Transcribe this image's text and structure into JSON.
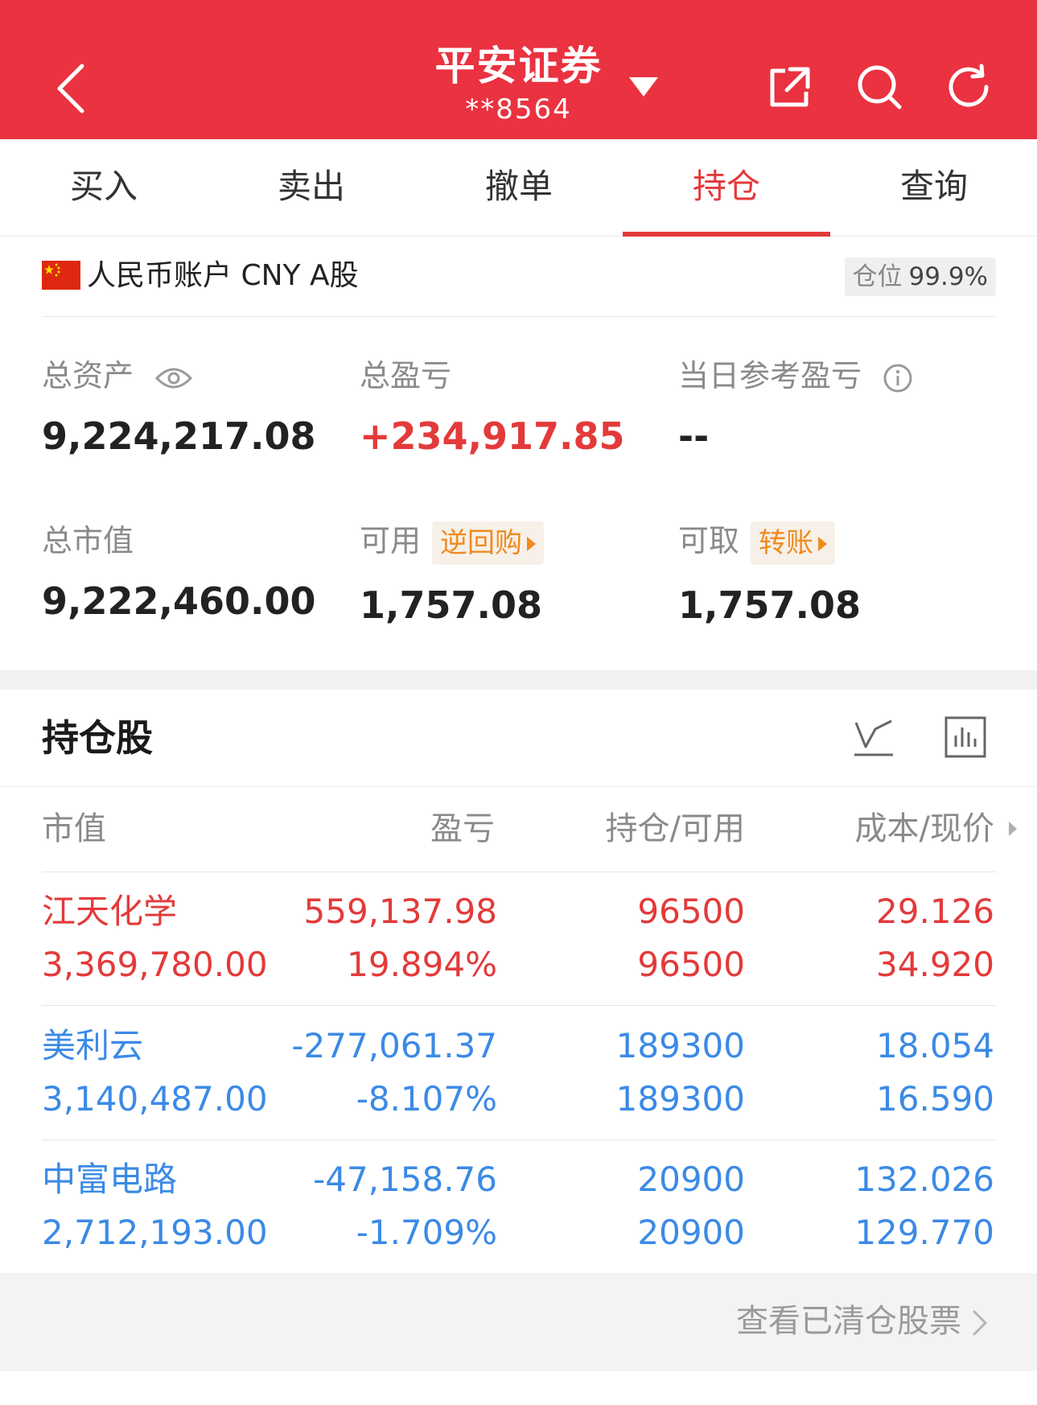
{
  "header": {
    "title": "平安证券",
    "account_masked": "**8564",
    "icons": [
      "back-icon",
      "dropdown-caret-icon",
      "share-icon",
      "search-icon",
      "refresh-icon"
    ]
  },
  "tabs": [
    {
      "label": "买入"
    },
    {
      "label": "卖出"
    },
    {
      "label": "撤单"
    },
    {
      "label": "持仓",
      "active": true
    },
    {
      "label": "查询"
    }
  ],
  "account": {
    "name": "人民币账户 CNY A股",
    "position_label": "仓位",
    "position_value": "99.9%"
  },
  "summary": {
    "total_assets_label": "总资产",
    "total_assets": "9,224,217.08",
    "total_pnl_label": "总盈亏",
    "total_pnl": "+234,917.85",
    "daily_pnl_label": "当日参考盈亏",
    "daily_pnl": "--",
    "market_value_label": "总市值",
    "market_value": "9,222,460.00",
    "available_label": "可用",
    "reverse_repo_label": "逆回购",
    "available": "1,757.08",
    "withdrawable_label": "可取",
    "transfer_label": "转账",
    "withdrawable": "1,757.08"
  },
  "holdings": {
    "title": "持仓股",
    "columns": [
      "市值",
      "盈亏",
      "持仓/可用",
      "成本/现价"
    ],
    "rows": [
      {
        "name": "江天化学",
        "market_value": "3,369,780.00",
        "pnl": "559,137.98",
        "pnl_pct": "19.894%",
        "position": "96500",
        "available": "96500",
        "cost": "29.126",
        "price": "34.920",
        "trend": "up"
      },
      {
        "name": "美利云",
        "market_value": "3,140,487.00",
        "pnl": "-277,061.37",
        "pnl_pct": "-8.107%",
        "position": "189300",
        "available": "189300",
        "cost": "18.054",
        "price": "16.590",
        "trend": "down"
      },
      {
        "name": "中富电路",
        "market_value": "2,712,193.00",
        "pnl": "-47,158.76",
        "pnl_pct": "-1.709%",
        "position": "20900",
        "available": "20900",
        "cost": "132.026",
        "price": "129.770",
        "trend": "down"
      }
    ],
    "footer_link": "查看已清仓股票"
  },
  "colors": {
    "brand_red": "#ea3240",
    "profit_red": "#e33a3a",
    "loss_blue": "#3b8ae6",
    "accent_orange": "#f08a1c"
  }
}
